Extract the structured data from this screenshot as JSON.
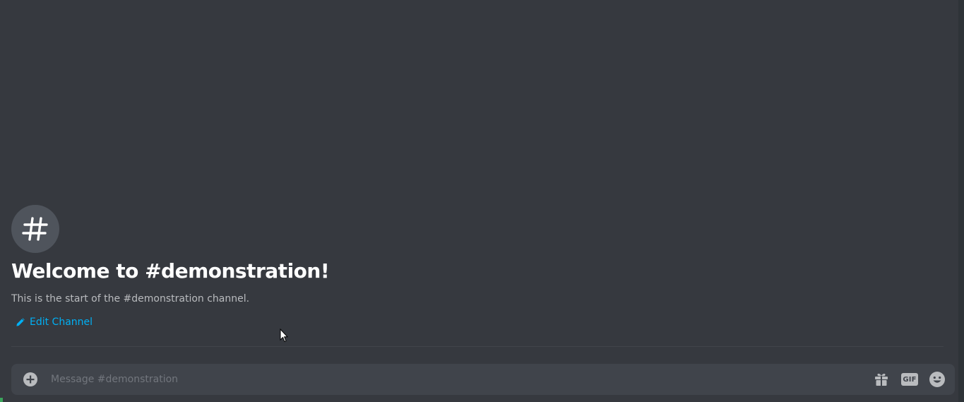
{
  "channel": {
    "icon": "hashtag-icon",
    "welcome_title": "Welcome to #demonstration!",
    "welcome_subtitle": "This is the start of the #demonstration channel.",
    "edit_label": "Edit Channel",
    "edit_icon": "pencil-icon"
  },
  "composer": {
    "placeholder": "Message #demonstration",
    "value": "",
    "attach_icon": "plus-circle-icon",
    "gift_icon": "gift-icon",
    "gif_label": "GIF",
    "emoji_icon": "smiley-icon"
  },
  "colors": {
    "background": "#36393f",
    "composer_background": "#40444b",
    "link": "#00b0f4",
    "title": "#ffffff",
    "subtitle": "#b9bbbe",
    "icon_circle": "#4f545c"
  }
}
